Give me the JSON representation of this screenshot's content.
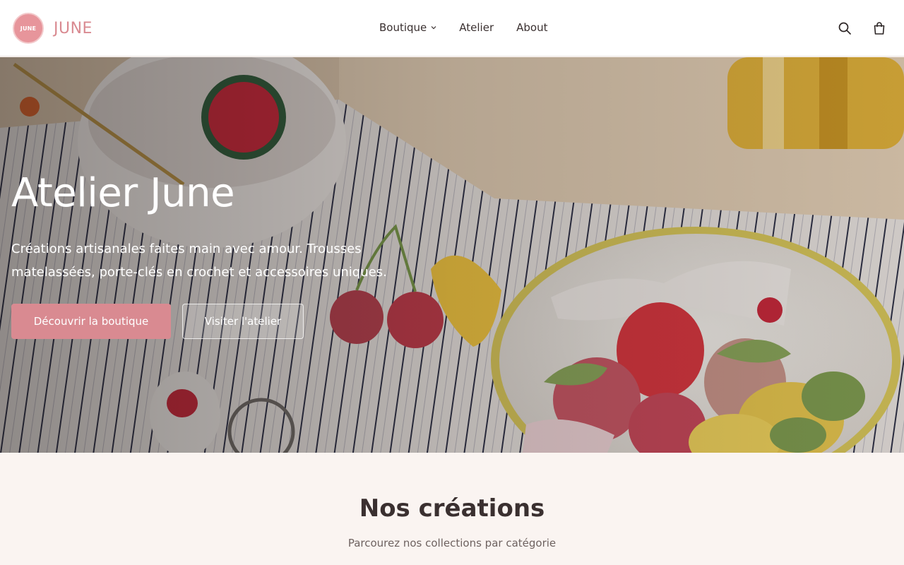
{
  "brand": {
    "badge_text": "JUNE",
    "name": "JUNE",
    "badge_color": "#e7959b",
    "accent_color": "#d98a91"
  },
  "nav": {
    "items": [
      {
        "label": "Boutique",
        "has_dropdown": true
      },
      {
        "label": "Atelier"
      },
      {
        "label": "About"
      }
    ],
    "icons": [
      "search-icon",
      "shopping-bag-icon"
    ]
  },
  "hero": {
    "title": "Atelier June",
    "subtitle": "Créations artisanales faites main avec amour. Trousses matelassées, porte-clés en crochet et accessoires uniques.",
    "primary_cta": "Découvrir la boutique",
    "secondary_cta": "Visiter l'atelier"
  },
  "section": {
    "title": "Nos créations",
    "subtitle": "Parcourez nos collections par catégorie"
  }
}
